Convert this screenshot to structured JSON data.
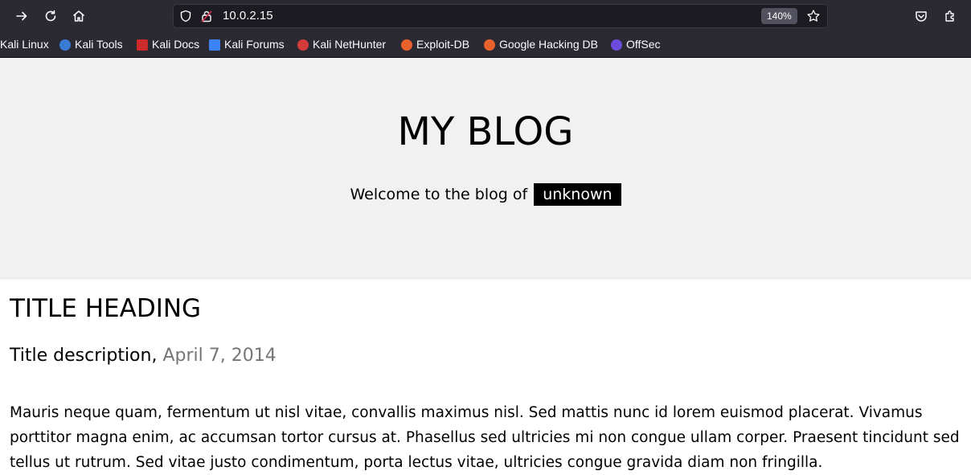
{
  "browser": {
    "url": "10.0.2.15",
    "zoom": "140%",
    "bookmarks": [
      {
        "label": "Kali Linux",
        "color": ""
      },
      {
        "label": "Kali Tools",
        "color": "#3a7bd5"
      },
      {
        "label": "Kali Docs",
        "color": "#cc2b2b"
      },
      {
        "label": "Kali Forums",
        "color": "#3b82f6"
      },
      {
        "label": "Kali NetHunter",
        "color": "#d33a3a"
      },
      {
        "label": "Exploit-DB",
        "color": "#e8622c"
      },
      {
        "label": "Google Hacking DB",
        "color": "#e8622c"
      },
      {
        "label": "OffSec",
        "color": "#6b4cdb"
      }
    ]
  },
  "page": {
    "site_title": "MY BLOG",
    "welcome_text": "Welcome to the blog of",
    "user_tag": "unknown",
    "post": {
      "title": "TITLE HEADING",
      "description": "Title description,",
      "date": "April 7, 2014",
      "body": "Mauris neque quam, fermentum ut nisl vitae, convallis maximus nisl. Sed mattis nunc id lorem euismod placerat. Vivamus porttitor magna enim, ac accumsan tortor cursus at. Phasellus sed ultricies mi non congue ullam corper. Praesent tincidunt sed tellus ut rutrum. Sed vitae justo condimentum, porta lectus vitae, ultricies congue gravida diam non fringilla."
    }
  }
}
